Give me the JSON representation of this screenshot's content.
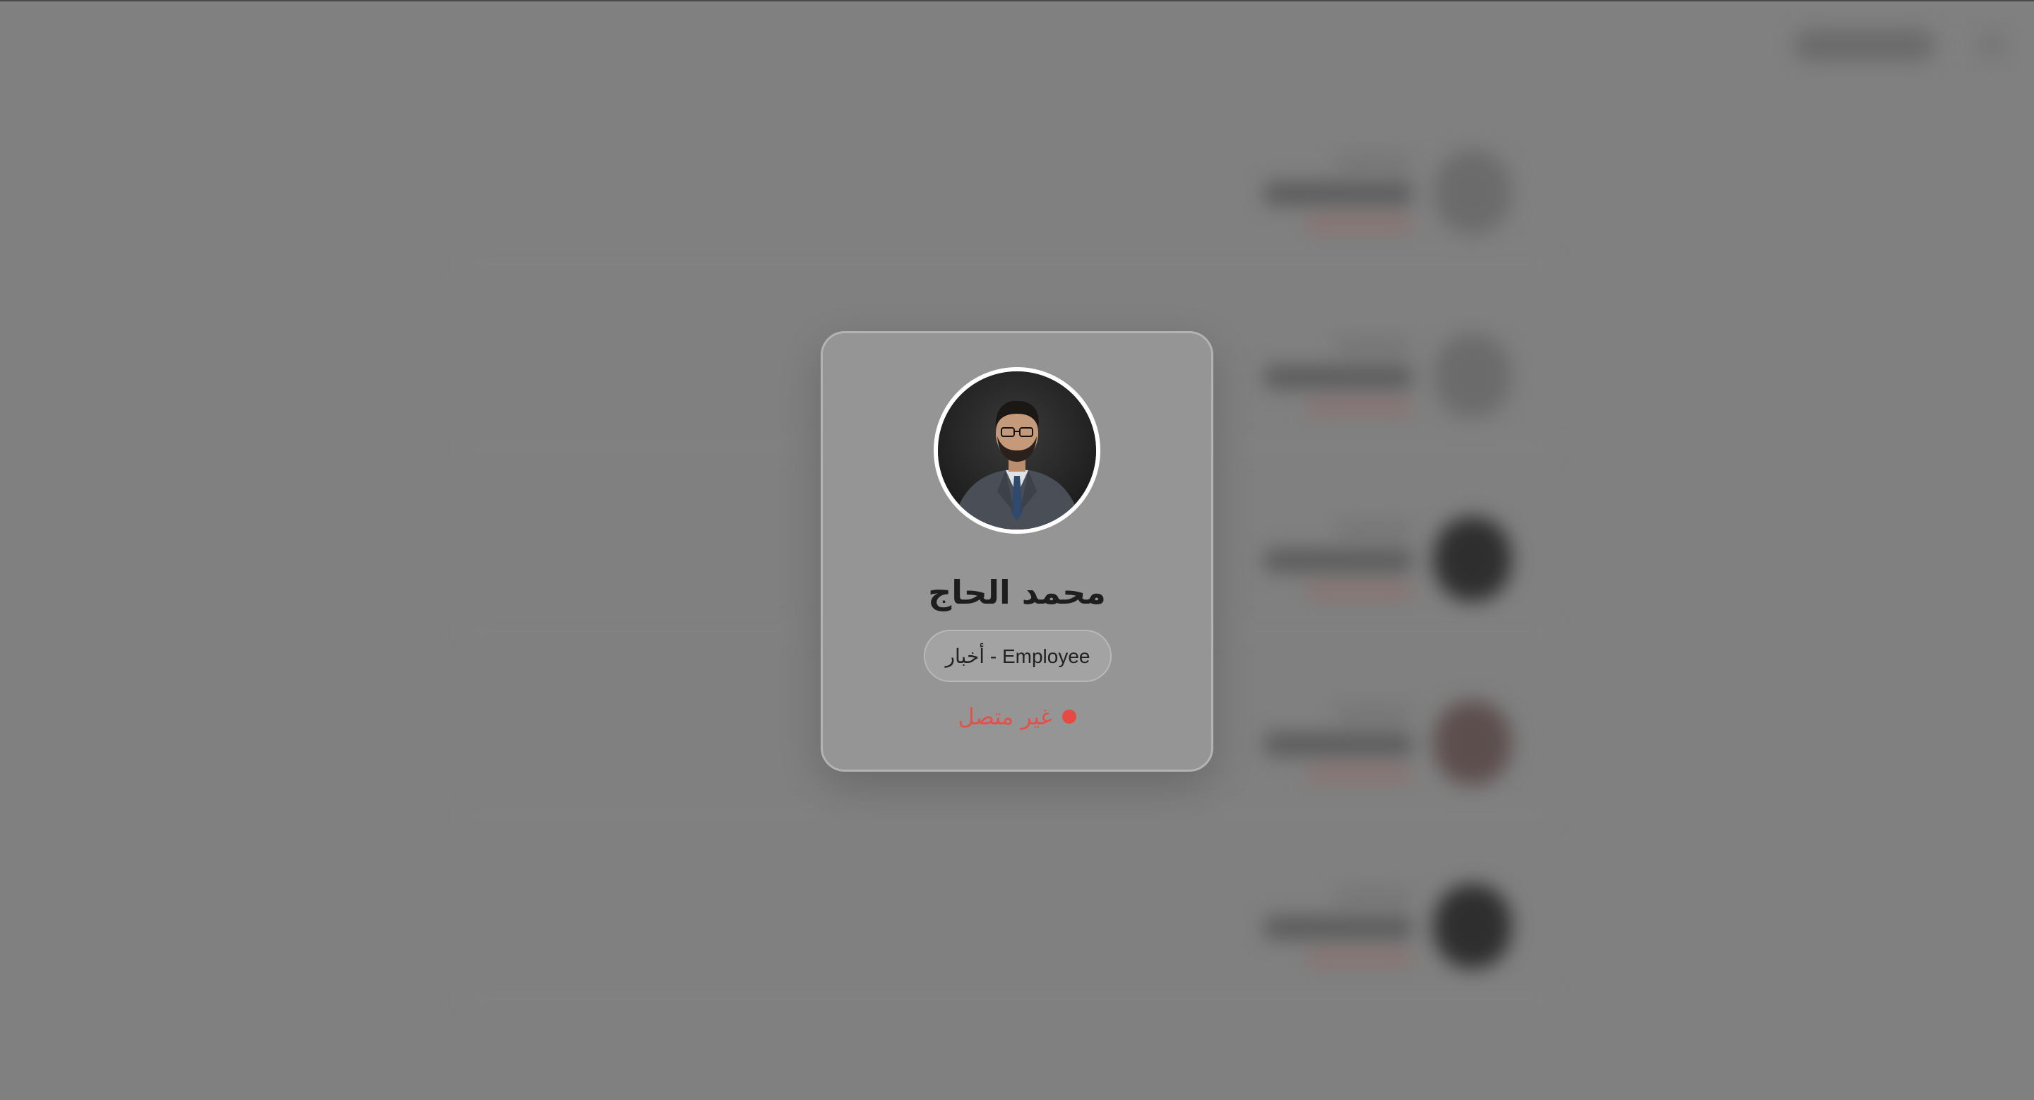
{
  "profile": {
    "name": "محمد الحاج",
    "role": "Employee - أخبار",
    "status_text": "غير متصل",
    "status_color": "#e64b43"
  },
  "background": {
    "rows_visible": 5
  },
  "colors": {
    "overlay": "#808080",
    "card": "#969696",
    "card_border": "#b3b3b3",
    "avatar_ring": "#ffffff",
    "name": "#1e1e1e"
  }
}
